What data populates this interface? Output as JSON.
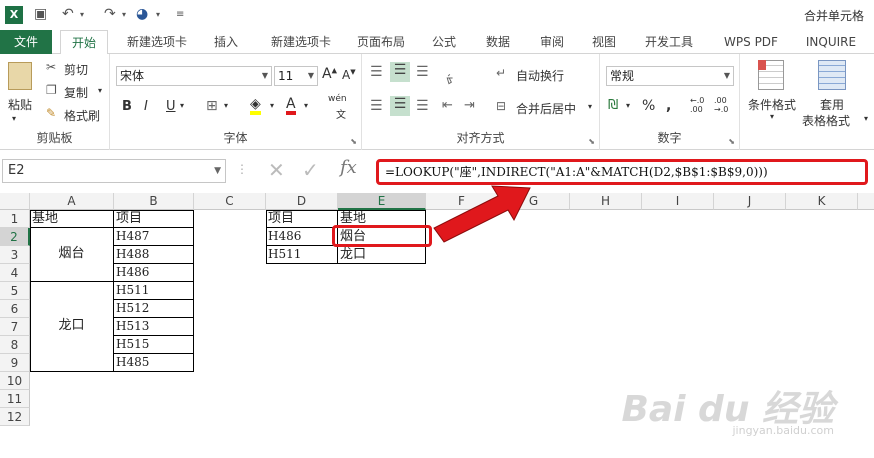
{
  "window": {
    "title": "合并单元格"
  },
  "tabs": {
    "file": "文件",
    "home": "开始",
    "t1": "新建选项卡",
    "insert": "插入",
    "t2": "新建选项卡",
    "layout": "页面布局",
    "formula": "公式",
    "data": "数据",
    "review": "审阅",
    "view": "视图",
    "dev": "开发工具",
    "wps": "WPS PDF",
    "inquire": "INQUIRE"
  },
  "ribbon": {
    "paste": "粘贴",
    "cut": "剪切",
    "copy": "复制",
    "painter": "格式刷",
    "clipboard": "剪贴板",
    "font_name": "宋体",
    "font_size": "11",
    "font_group": "字体",
    "wen": "wén",
    "wrap": "自动换行",
    "merge": "合并后居中",
    "align_group": "对齐方式",
    "num_format": "常规",
    "num_group": "数字",
    "percent": "%",
    "cond_format": "条件格式",
    "table_format1": "套用",
    "table_format2": "表格格式"
  },
  "formula_bar": {
    "name_box": "E2",
    "fx": "fx",
    "formula": "=LOOKUP(\"座\",INDIRECT(\"A1:A\"&MATCH(D2,$B$1:$B$9,0)))"
  },
  "columns": [
    "A",
    "B",
    "C",
    "D",
    "E",
    "F",
    "G",
    "H",
    "I",
    "J",
    "K"
  ],
  "rows": [
    "1",
    "2",
    "3",
    "4",
    "5",
    "6",
    "7",
    "8",
    "9",
    "10",
    "11",
    "12"
  ],
  "cells": {
    "A1": "基地",
    "B1": "项目",
    "A2": "烟台",
    "A5": "龙口",
    "B2": "H487",
    "B3": "H488",
    "B4": "H486",
    "B5": "H511",
    "B6": "H512",
    "B7": "H513",
    "B8": "H515",
    "B9": "H485",
    "D1": "项目",
    "E1": "基地",
    "D2": "H486",
    "E2": "烟台",
    "D3": "H511",
    "E3": "龙口"
  },
  "watermark": {
    "logo": "Bai du 经验",
    "url": "jingyan.baidu.com"
  },
  "colors": {
    "excel_green": "#217346",
    "highlight_red": "#e0181c"
  }
}
